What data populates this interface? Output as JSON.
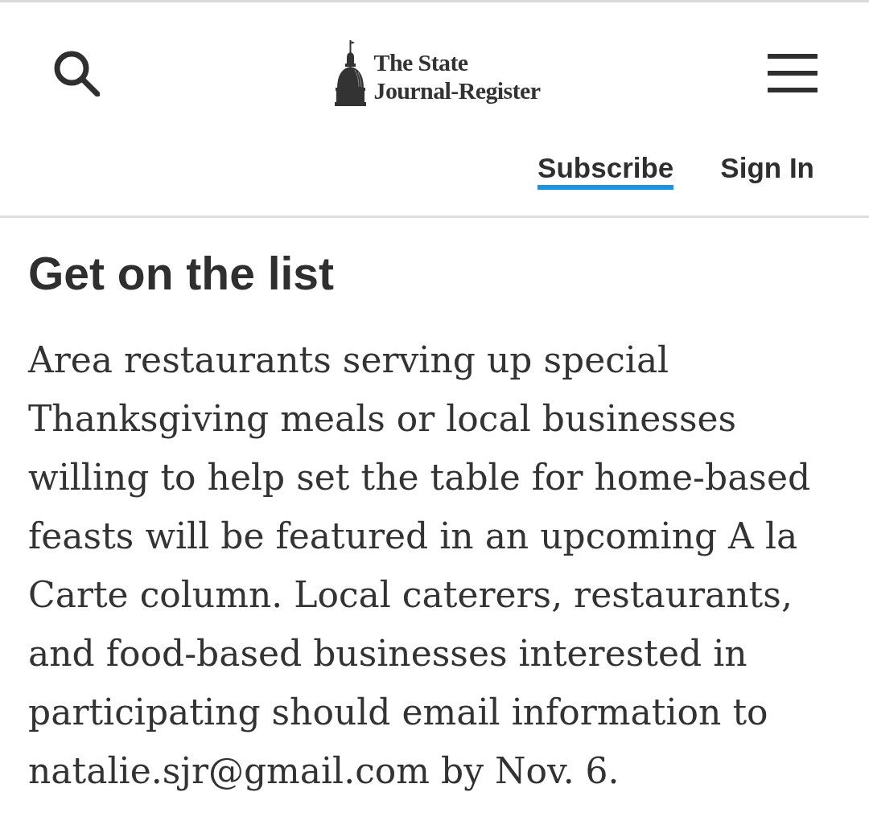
{
  "header": {
    "logo": {
      "lines": [
        "The State",
        "Journal-Register"
      ]
    },
    "nav_links": [
      {
        "label": "Subscribe",
        "highlighted": true
      },
      {
        "label": "Sign In",
        "highlighted": false
      }
    ]
  },
  "article": {
    "heading": "Get on the list",
    "paragraph": "Area restaurants serving up special Thanksgiving meals or local businesses willing to help set the table for home-based feasts will be featured in an upcoming A la Carte column. Local caterers, restaurants, and food-based businesses interested in participating should email information to natalie.sjr@gmail.com by Nov. 6."
  }
}
